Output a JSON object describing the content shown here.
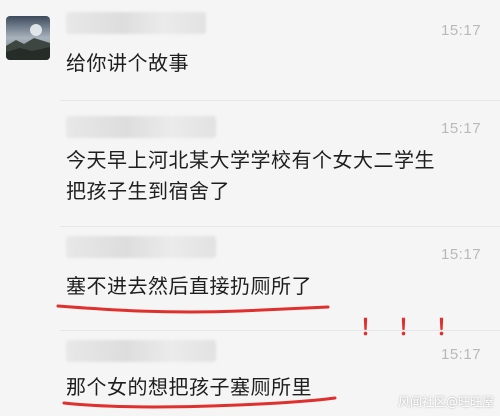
{
  "messages": [
    {
      "time": "15:17",
      "text": "给你讲个故事"
    },
    {
      "time": "15:17",
      "line1": "今天早上河北某大学学校有个女大二学生",
      "line2": "把孩子生到宿舍了"
    },
    {
      "time": "15:17",
      "text": "塞不进去然后直接扔厕所了"
    },
    {
      "time": "15:17",
      "text": "那个女的想把孩子塞厕所里"
    }
  ],
  "annotation": {
    "marks": "！！！",
    "color": "#e0302d"
  },
  "watermark": "风闻社区@旺旺屋",
  "colors": {
    "background": "#f5f5f5",
    "timestamp": "#b9b9b9",
    "annotation": "#e0302d"
  }
}
